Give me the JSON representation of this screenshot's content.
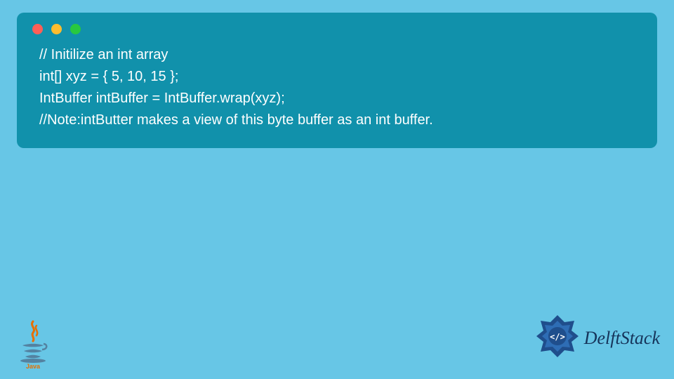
{
  "code": {
    "line1": "// Initilize an int array",
    "line2": "int[] xyz = { 5, 10, 15 };",
    "line3": "IntBuffer intBuffer = IntBuffer.wrap(xyz);",
    "line4": "//Note:intButter makes a view of this byte buffer as an int buffer."
  },
  "brand": {
    "name": "DelftStack",
    "java_label": "Java"
  },
  "colors": {
    "page_bg": "#67c6e6",
    "card_bg": "#1191ab",
    "code_text": "#ffffff",
    "brand_text": "#16345a"
  }
}
